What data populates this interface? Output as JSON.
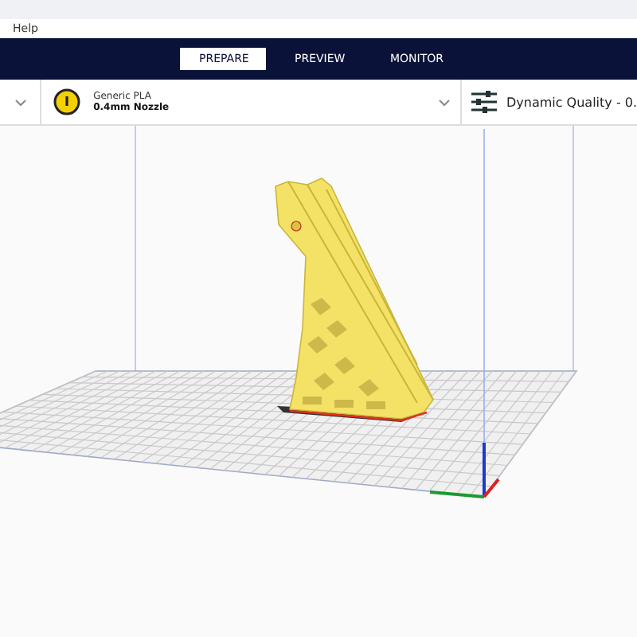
{
  "menu_bar": {
    "items": [
      "Help"
    ]
  },
  "stages": [
    {
      "label": "PREPARE",
      "selected": true
    },
    {
      "label": "PREVIEW",
      "selected": false
    },
    {
      "label": "MONITOR",
      "selected": false
    }
  ],
  "toolbar": {
    "extruder": {
      "material": "Generic PLA",
      "nozzle": "0.4mm Nozzle"
    },
    "print_settings": {
      "label": "Dynamic Quality - 0."
    }
  }
}
